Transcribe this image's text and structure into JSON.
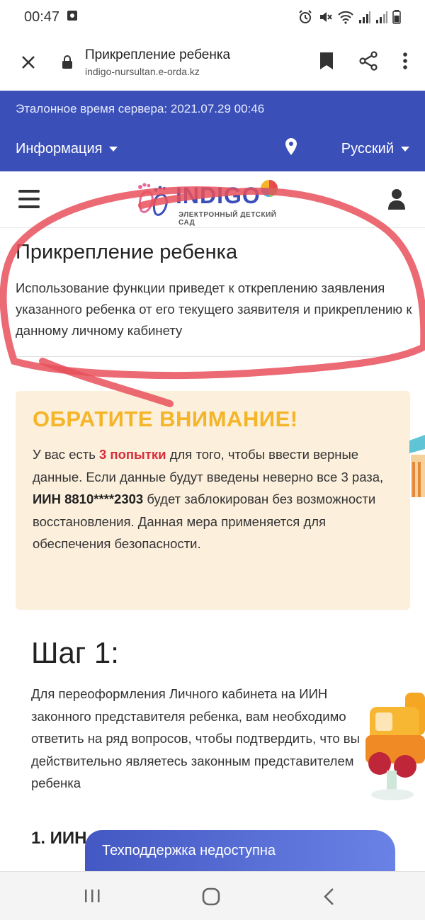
{
  "status_bar": {
    "time": "00:47"
  },
  "browser": {
    "title": "Прикрепление ребенка",
    "url": "indigo-nursultan.e-orda.kz"
  },
  "header": {
    "server_time": "Эталонное время сервера: 2021.07.29 00:46",
    "info_menu": "Информация",
    "language": "Русский",
    "accent_color": "#3a4fb8"
  },
  "logo": {
    "text": "INDIGO",
    "subtitle": "ЭЛЕКТРОННЫЙ ДЕТСКИЙ САД"
  },
  "page": {
    "title": "Прикрепление ребенка",
    "description": "Использование функции приведет к откреплению заявления указанного ребенка от его текущего заявителя и прикреплению к данному личному кабинету"
  },
  "notice": {
    "title": "ОБРАТИТЕ ВНИМАНИЕ!",
    "text_1": "У вас есть ",
    "attempts": "3 попытки",
    "text_2": " для того, чтобы ввести верные данные. Если данные будут введены неверно все 3 раза, ",
    "iin": "ИИН 8810****2303",
    "text_3": " будет заблокирован без возможности восстановления. Данная мера применяется для обеспечения безопасности.",
    "title_color": "#f5b529",
    "highlight_color": "#d62d3a"
  },
  "step": {
    "title": "Шаг 1:",
    "text": "Для переоформления Личного кабинета на ИИН законного представителя ребенка, вам необходимо ответить на ряд вопросов, чтобы подтвердить, что вы действительно являетесь законным представителем ребенка",
    "question": "1. ИИН"
  },
  "support": {
    "label": "Техподдержка недоступна"
  }
}
